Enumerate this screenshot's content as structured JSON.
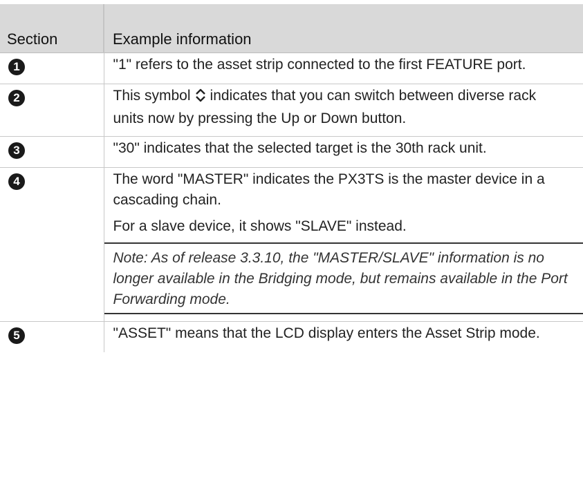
{
  "table": {
    "headers": [
      "Section",
      "Example information"
    ],
    "rows": [
      {
        "number": "1",
        "text": "\"1\" refers to the asset strip connected to the first FEATURE port."
      },
      {
        "number": "2",
        "text_before_icon": "This symbol",
        "icon": "up-down-chevron-icon",
        "text_after_icon": "indicates that you can switch between diverse rack units now by pressing the Up or Down button."
      },
      {
        "number": "3",
        "text": "\"30\" indicates that the selected target is the 30th rack unit."
      },
      {
        "number": "4",
        "text": "The word \"MASTER\" indicates the PX3TS is the master device in a cascading chain.",
        "text2": "For a slave device, it shows \"SLAVE\" instead.",
        "note": "Note: As of release 3.3.10, the \"MASTER/SLAVE\" information is no longer available in the Bridging mode, but remains available in the Port Forwarding mode."
      },
      {
        "number": "5",
        "text": "\"ASSET\" means that the LCD display enters the Asset Strip mode."
      }
    ]
  }
}
